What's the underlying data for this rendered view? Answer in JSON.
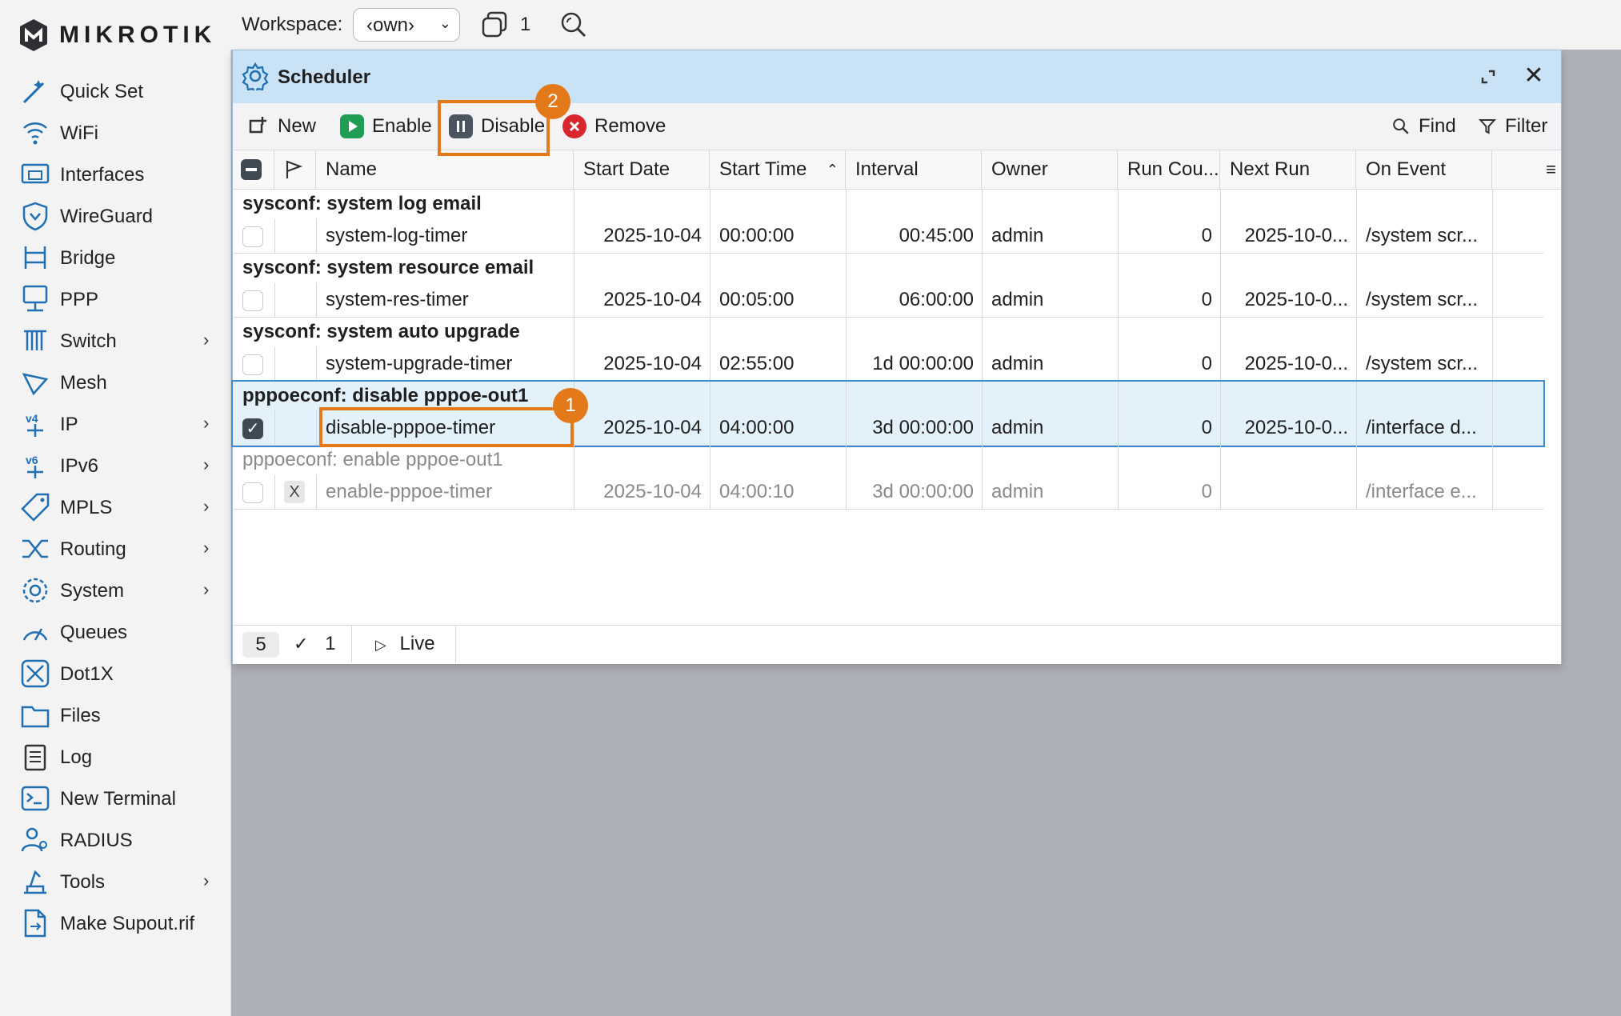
{
  "brand": {
    "name": "MIKROTIK"
  },
  "sidebar": {
    "items": [
      {
        "label": "Quick Set",
        "icon": "wand-icon",
        "arrow": false
      },
      {
        "label": "WiFi",
        "icon": "wifi-icon",
        "arrow": false
      },
      {
        "label": "Interfaces",
        "icon": "interfaces-icon",
        "arrow": false
      },
      {
        "label": "WireGuard",
        "icon": "wireguard-shield-icon",
        "arrow": false
      },
      {
        "label": "Bridge",
        "icon": "bridge-icon",
        "arrow": false
      },
      {
        "label": "PPP",
        "icon": "ppp-icon",
        "arrow": false
      },
      {
        "label": "Switch",
        "icon": "switch-icon",
        "arrow": true
      },
      {
        "label": "Mesh",
        "icon": "mesh-icon",
        "arrow": false
      },
      {
        "label": "IP",
        "icon": "ipv4-icon",
        "arrow": true
      },
      {
        "label": "IPv6",
        "icon": "ipv6-icon",
        "arrow": true
      },
      {
        "label": "MPLS",
        "icon": "mpls-tag-icon",
        "arrow": true
      },
      {
        "label": "Routing",
        "icon": "routing-icon",
        "arrow": true
      },
      {
        "label": "System",
        "icon": "gear-icon",
        "arrow": true
      },
      {
        "label": "Queues",
        "icon": "gauge-icon",
        "arrow": false
      },
      {
        "label": "Dot1X",
        "icon": "dot1x-icon",
        "arrow": false
      },
      {
        "label": "Files",
        "icon": "folder-icon",
        "arrow": false
      },
      {
        "label": "Log",
        "icon": "log-icon",
        "arrow": false
      },
      {
        "label": "New Terminal",
        "icon": "terminal-icon",
        "arrow": false
      },
      {
        "label": "RADIUS",
        "icon": "radius-icon",
        "arrow": false
      },
      {
        "label": "Tools",
        "icon": "tools-icon",
        "arrow": true
      },
      {
        "label": "Make Supout.rif",
        "icon": "supout-file-icon",
        "arrow": false
      }
    ]
  },
  "topbar": {
    "workspace_label": "Workspace:",
    "workspace_value": "‹own›",
    "windows_count": "1"
  },
  "window": {
    "title": "Scheduler",
    "toolbar": {
      "new": "New",
      "enable": "Enable",
      "disable": "Disable",
      "remove": "Remove",
      "find": "Find",
      "filter": "Filter"
    },
    "columns": [
      "Name",
      "Start Date",
      "Start Time",
      "Interval",
      "Owner",
      "Run Cou...",
      "Next Run",
      "On Event"
    ],
    "rows": [
      {
        "group": "sysconf: system log email",
        "name": "system-log-timer",
        "start_date": "2025-10-04",
        "start_time": "00:00:00",
        "interval": "00:45:00",
        "owner": "admin",
        "run_count": "0",
        "next_run": "2025-10-0...",
        "on_event": "/system scr...",
        "checked": false,
        "disabled": false,
        "selected": false
      },
      {
        "group": "sysconf: system resource email",
        "name": "system-res-timer",
        "start_date": "2025-10-04",
        "start_time": "00:05:00",
        "interval": "06:00:00",
        "owner": "admin",
        "run_count": "0",
        "next_run": "2025-10-0...",
        "on_event": "/system scr...",
        "checked": false,
        "disabled": false,
        "selected": false
      },
      {
        "group": "sysconf: system auto upgrade",
        "name": "system-upgrade-timer",
        "start_date": "2025-10-04",
        "start_time": "02:55:00",
        "interval": "1d 00:00:00",
        "owner": "admin",
        "run_count": "0",
        "next_run": "2025-10-0...",
        "on_event": "/system scr...",
        "checked": false,
        "disabled": false,
        "selected": false
      },
      {
        "group": "pppoeconf: disable pppoe-out1",
        "name": "disable-pppoe-timer",
        "start_date": "2025-10-04",
        "start_time": "04:00:00",
        "interval": "3d 00:00:00",
        "owner": "admin",
        "run_count": "0",
        "next_run": "2025-10-0...",
        "on_event": "/interface d...",
        "checked": true,
        "disabled": false,
        "selected": true
      },
      {
        "group": "pppoeconf: enable pppoe-out1",
        "name": "enable-pppoe-timer",
        "start_date": "2025-10-04",
        "start_time": "04:00:10",
        "interval": "3d 00:00:00",
        "owner": "admin",
        "run_count": "0",
        "next_run": "",
        "on_event": "/interface e...",
        "checked": false,
        "disabled": true,
        "disabled_flag": "X",
        "selected": false
      }
    ],
    "status": {
      "total": "5",
      "selected": "1",
      "live": "Live"
    }
  },
  "annotations": {
    "step1": "1",
    "step2": "2"
  },
  "colors": {
    "accent": "#e4791a",
    "title_bar": "#c9e2f5",
    "selected_row": "#e3f1fb",
    "enable_green": "#1f9d55",
    "remove_red": "#d8262d"
  }
}
